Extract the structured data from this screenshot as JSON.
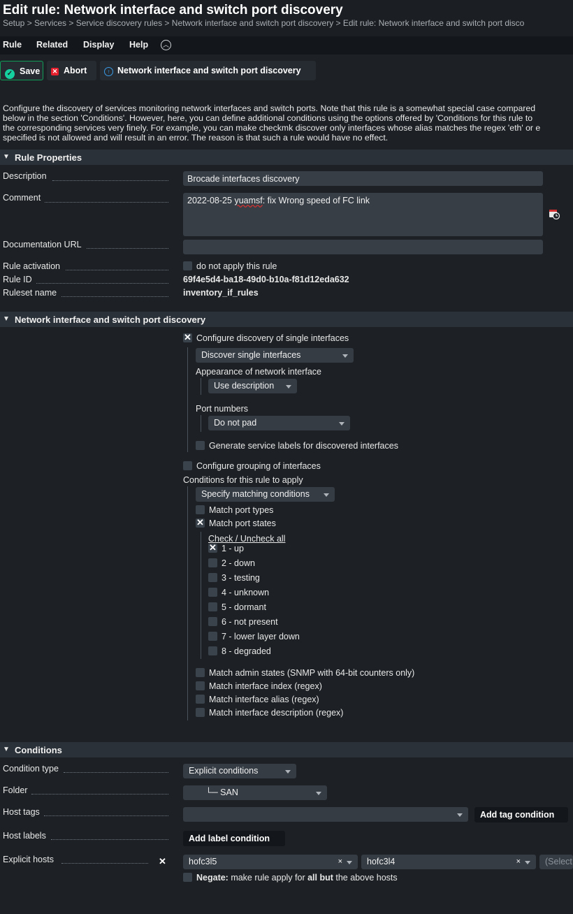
{
  "header": {
    "title": "Edit rule: Network interface and switch port discovery",
    "breadcrumb": "Setup > Services > Service discovery rules > Network interface and switch port discovery > Edit rule: Network interface and switch port disco"
  },
  "menu": {
    "rule": "Rule",
    "related": "Related",
    "display": "Display",
    "help": "Help"
  },
  "toolbar": {
    "save": "Save",
    "abort": "Abort",
    "ruleset_link": "Network interface and switch port discovery"
  },
  "intro": {
    "line1": "Configure the discovery of services monitoring network interfaces and switch ports. Note that this rule is a somewhat special case compared",
    "line2": "below in the section 'Conditions'. However, here, you can define additional conditions using the options offered by 'Conditions for this rule to",
    "line3": "the corresponding services very finely. For example, you can make checkmk discover only interfaces whose alias matches the regex 'eth' or e",
    "line4": "specified is not allowed and will result in an error. The reason is that such a rule would have no effect."
  },
  "rule_properties": {
    "header": "Rule Properties",
    "description_label": "Description",
    "description_value": "Brocade interfaces discovery",
    "comment_label": "Comment",
    "comment_value_date": "2022-08-25",
    "comment_value_user": "yuamsf",
    "comment_value_rest": ": fix Wrong speed of FC link",
    "doc_url_label": "Documentation URL",
    "doc_url_value": "",
    "activation_label": "Rule activation",
    "activation_checkbox": "do not apply this rule",
    "rule_id_label": "Rule ID",
    "rule_id_value": "69f4e5d4-ba18-49d0-b10a-f81d12eda632",
    "ruleset_name_label": "Ruleset name",
    "ruleset_name_value": "inventory_if_rules"
  },
  "discovery": {
    "header": "Network interface and switch port discovery",
    "single_interfaces": "Configure discovery of single interfaces",
    "discover_select": "Discover single interfaces",
    "appearance_label": "Appearance of network interface",
    "appearance_select": "Use description",
    "port_numbers_label": "Port numbers",
    "port_numbers_select": "Do not pad",
    "gen_labels": "Generate service labels for discovered interfaces",
    "grouping": "Configure grouping of interfaces",
    "conditions_label": "Conditions for this rule to apply",
    "conditions_select": "Specify matching conditions",
    "match_port_types": "Match port types",
    "match_port_states": "Match port states",
    "check_uncheck_all": "Check / Uncheck all",
    "states": [
      {
        "label": "1 - up",
        "checked": true
      },
      {
        "label": "2 - down",
        "checked": false
      },
      {
        "label": "3 - testing",
        "checked": false
      },
      {
        "label": "4 - unknown",
        "checked": false
      },
      {
        "label": "5 - dormant",
        "checked": false
      },
      {
        "label": "6 - not present",
        "checked": false
      },
      {
        "label": "7 - lower layer down",
        "checked": false
      },
      {
        "label": "8 - degraded",
        "checked": false
      }
    ],
    "match_admin": "Match admin states (SNMP with 64-bit counters only)",
    "match_index": "Match interface index (regex)",
    "match_alias": "Match interface alias (regex)",
    "match_description": "Match interface description (regex)"
  },
  "conditions": {
    "header": "Conditions",
    "condition_type_label": "Condition type",
    "condition_type_value": "Explicit conditions",
    "folder_label": "Folder",
    "folder_value": "└─ SAN",
    "host_tags_label": "Host tags",
    "add_tag_condition": "Add tag condition",
    "host_labels_label": "Host labels",
    "add_label_condition": "Add label condition",
    "explicit_hosts_label": "Explicit hosts",
    "hosts": [
      "hofc3l5",
      "hofc3l4"
    ],
    "hosts_placeholder": "(Select",
    "negate_bold": "Negate:",
    "negate_text1": " make rule apply for ",
    "negate_bold2": "all but",
    "negate_text2": " the above hosts"
  }
}
